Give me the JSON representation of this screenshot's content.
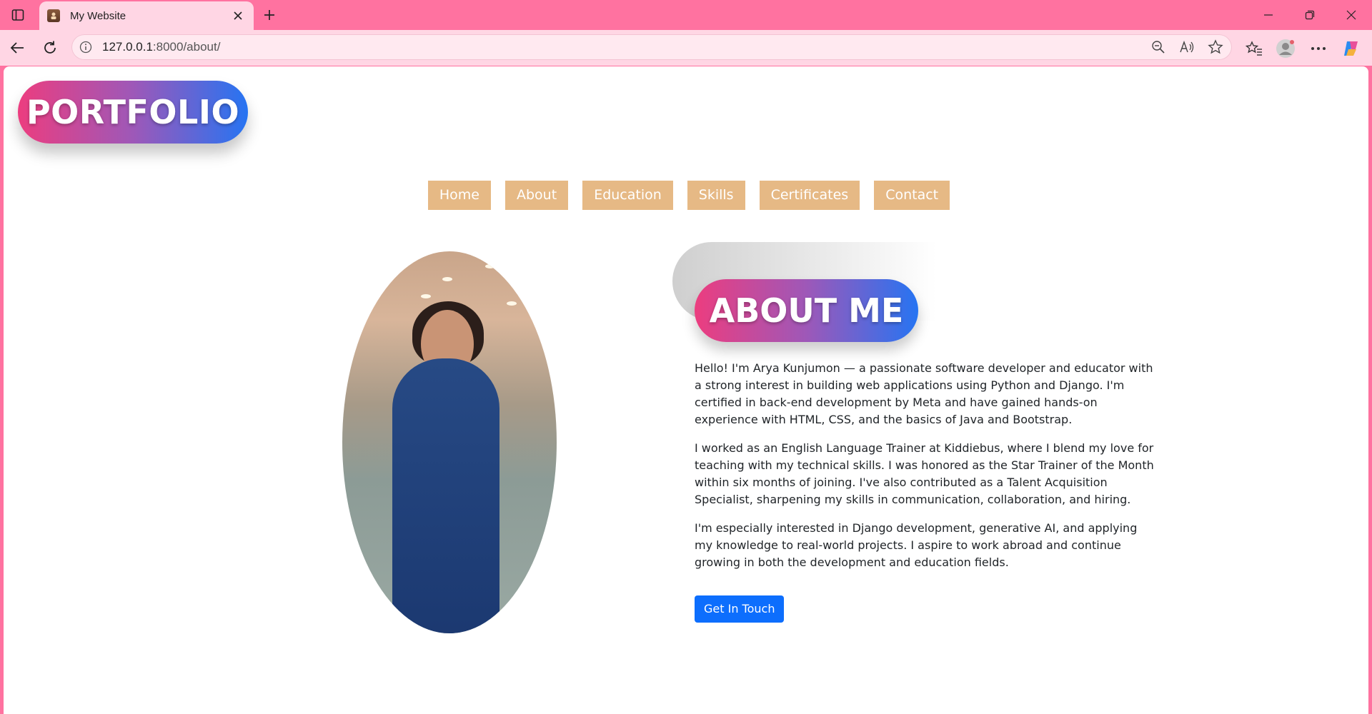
{
  "browser": {
    "tab_title": "My Website",
    "url_host": "127.0.0.1",
    "url_rest": ":8000/about/"
  },
  "site": {
    "logo_text": "PORTFOLIO",
    "nav": [
      "Home",
      "About",
      "Education",
      "Skills",
      "Certificates",
      "Contact"
    ]
  },
  "about": {
    "title": "ABOUT ME",
    "paragraphs": [
      "Hello! I'm Arya Kunjumon — a passionate software developer and educator with a strong interest in building web applications using Python and Django. I'm certified in back-end development by Meta and have gained hands-on experience with HTML, CSS, and the basics of Java and Bootstrap.",
      "I worked as an English Language Trainer at Kiddiebus, where I blend my love for teaching with my technical skills. I was honored as the Star Trainer of the Month within six months of joining. I've also contributed as a Talent Acquisition Specialist, sharpening my skills in communication, collaboration, and hiring.",
      "I'm especially interested in Django development, generative AI, and applying my knowledge to real-world projects. I aspire to work abroad and continue growing in both the development and education fields."
    ],
    "cta_label": "Get In Touch"
  },
  "colors": {
    "chrome": "#ff72a0",
    "toolbar": "#ffd6e4",
    "nav_bg": "#e6b985",
    "cta": "#0d6efd",
    "gradient_start": "#ec3d7f",
    "gradient_end": "#2674f2"
  },
  "icons": [
    "sidebar-toggle-icon",
    "close-icon",
    "plus-icon",
    "back-arrow-icon",
    "reload-icon",
    "info-icon",
    "zoom-out-icon",
    "read-aloud-icon",
    "star-icon",
    "favorites-icon",
    "profile-icon",
    "more-icon",
    "copilot-icon"
  ]
}
